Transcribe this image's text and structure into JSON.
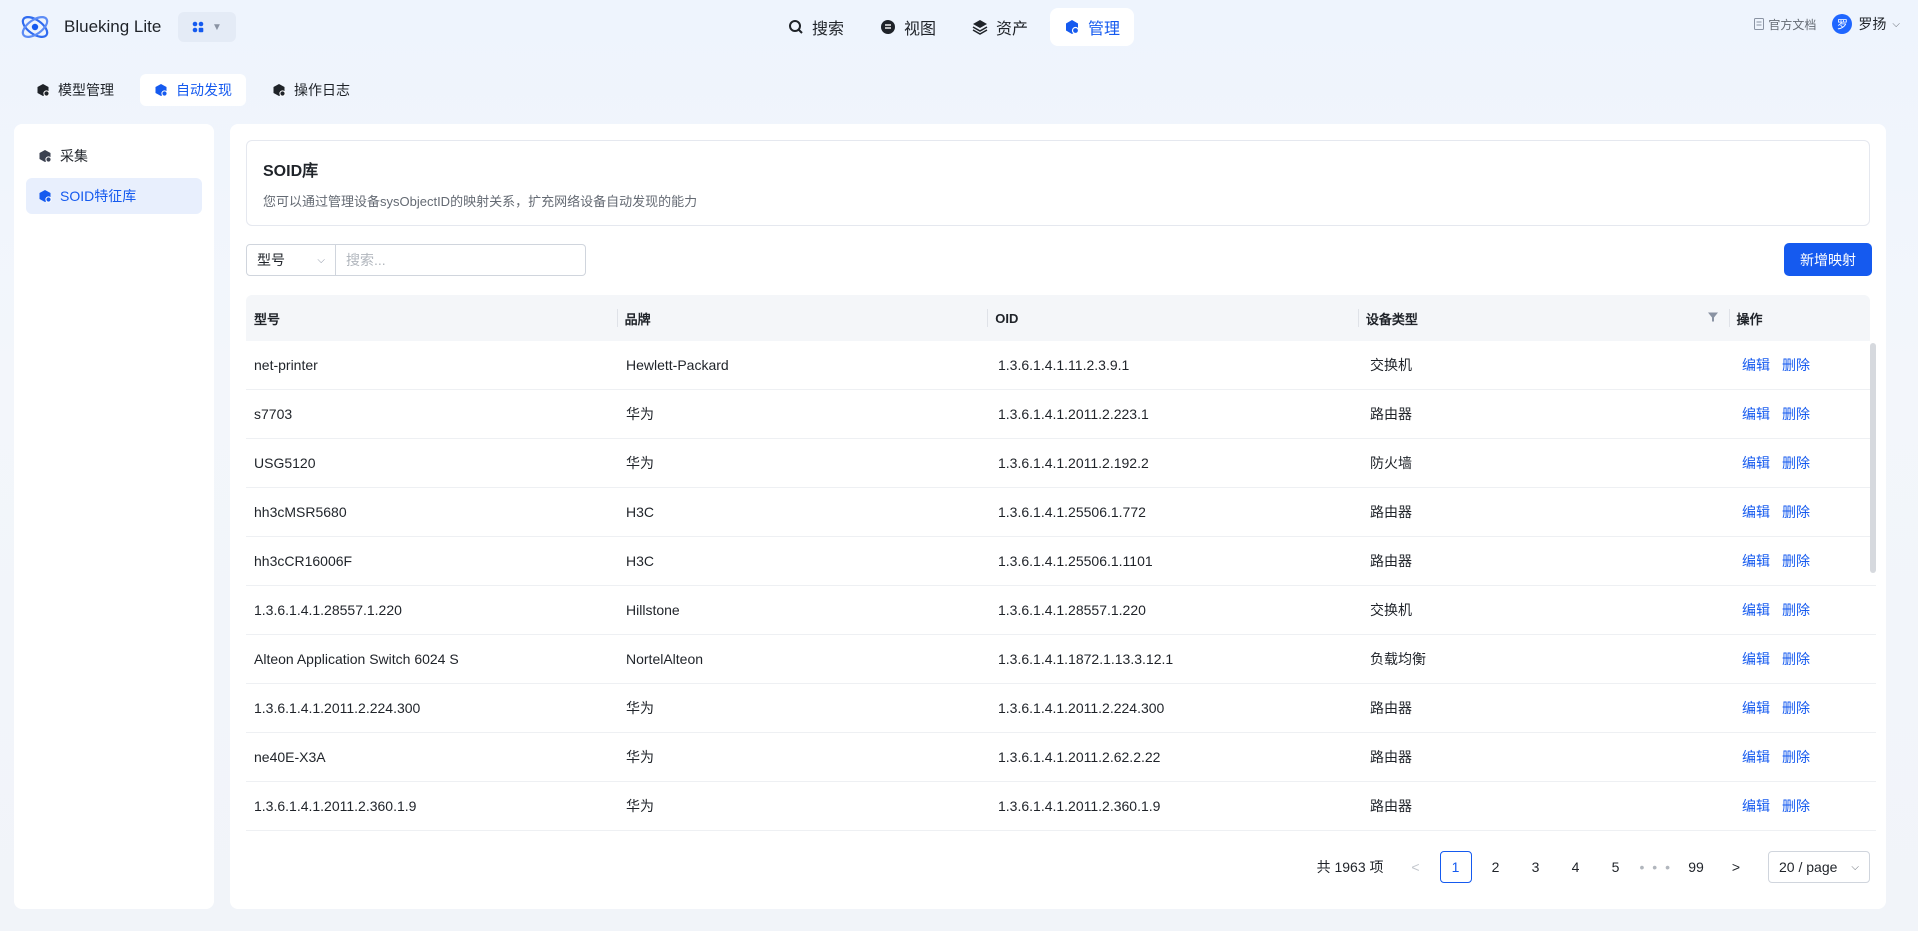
{
  "app": {
    "title": "Blueking Lite"
  },
  "topnav": [
    {
      "label": "搜索",
      "icon": "search-icon"
    },
    {
      "label": "视图",
      "icon": "view-icon"
    },
    {
      "label": "资产",
      "icon": "layers-icon"
    },
    {
      "label": "管理",
      "icon": "manage-icon",
      "active": true
    }
  ],
  "header": {
    "docs_label": "官方文档",
    "avatar_text": "罗",
    "user_name": "罗扬"
  },
  "subtabs": [
    {
      "label": "模型管理"
    },
    {
      "label": "自动发现",
      "active": true
    },
    {
      "label": "操作日志"
    }
  ],
  "sidebar": {
    "items": [
      {
        "label": "采集"
      },
      {
        "label": "SOID特征库",
        "active": true
      }
    ]
  },
  "intro": {
    "title": "SOID库",
    "description": "您可以通过管理设备sysObjectID的映射关系，扩充网络设备自动发现的能力"
  },
  "filter": {
    "field": "型号",
    "placeholder": "搜索..."
  },
  "add_button": "新增映射",
  "table": {
    "columns": [
      "型号",
      "品牌",
      "OID",
      "设备类型",
      "操作"
    ],
    "actions": {
      "edit": "编辑",
      "delete": "删除"
    },
    "rows": [
      [
        "net-printer",
        "Hewlett-Packard",
        "1.3.6.1.4.1.11.2.3.9.1",
        "交换机"
      ],
      [
        "s7703",
        "华为",
        "1.3.6.1.4.1.2011.2.223.1",
        "路由器"
      ],
      [
        "USG5120",
        "华为",
        "1.3.6.1.4.1.2011.2.192.2",
        "防火墙"
      ],
      [
        "hh3cMSR5680",
        "H3C",
        "1.3.6.1.4.1.25506.1.772",
        "路由器"
      ],
      [
        "hh3cCR16006F",
        "H3C",
        "1.3.6.1.4.1.25506.1.1101",
        "路由器"
      ],
      [
        "1.3.6.1.4.1.28557.1.220",
        "Hillstone",
        "1.3.6.1.4.1.28557.1.220",
        "交换机"
      ],
      [
        "Alteon Application Switch 6024 S",
        "NortelAlteon",
        "1.3.6.1.4.1.1872.1.13.3.12.1",
        "负载均衡"
      ],
      [
        "1.3.6.1.4.1.2011.2.224.300",
        "华为",
        "1.3.6.1.4.1.2011.2.224.300",
        "路由器"
      ],
      [
        "ne40E-X3A",
        "华为",
        "1.3.6.1.4.1.2011.2.62.2.22",
        "路由器"
      ],
      [
        "1.3.6.1.4.1.2011.2.360.1.9",
        "华为",
        "1.3.6.1.4.1.2011.2.360.1.9",
        "路由器"
      ]
    ]
  },
  "pagination": {
    "total_label": "共 1963 项",
    "prev": "<",
    "next": ">",
    "pages": [
      "1",
      "2",
      "3",
      "4",
      "5"
    ],
    "ellipsis": "• • •",
    "last": "99",
    "current": "1",
    "page_size": "20 / page"
  },
  "colors": {
    "accent": "#155aef"
  }
}
